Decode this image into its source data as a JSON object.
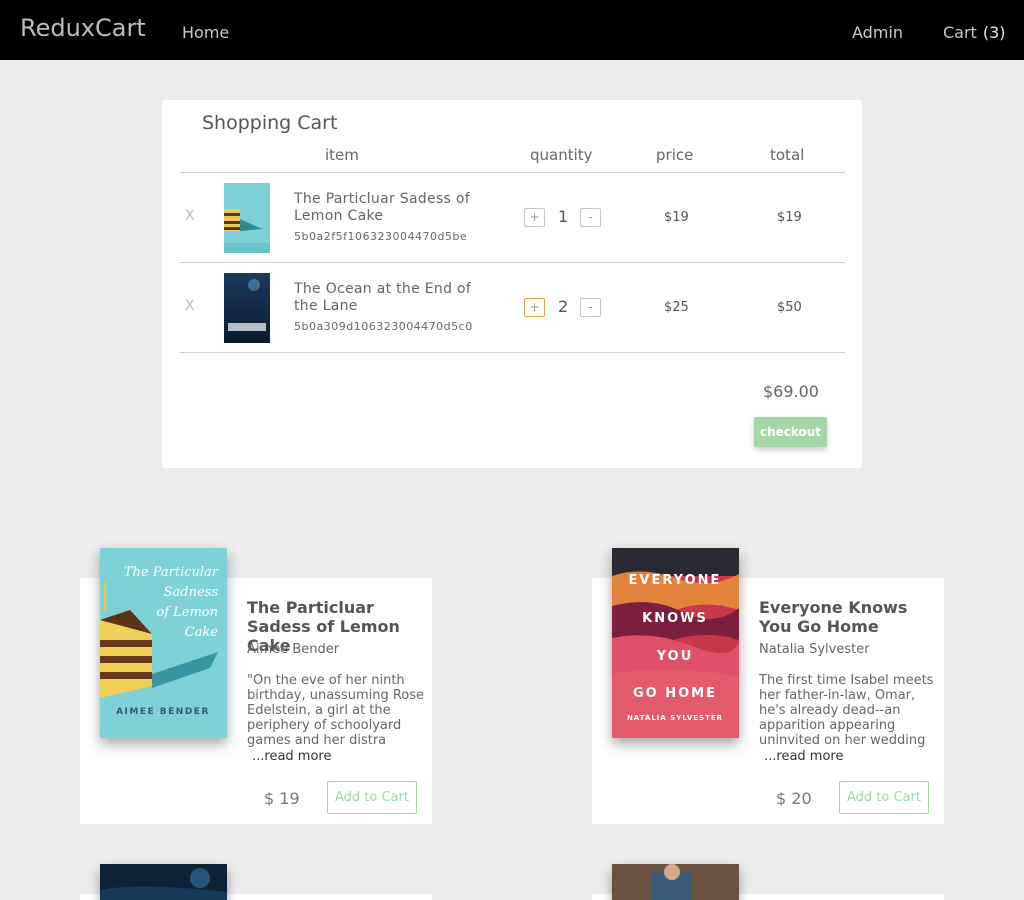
{
  "nav": {
    "brand": "ReduxCart",
    "home": "Home",
    "admin": "Admin",
    "cart_label": "Cart",
    "cart_count": "(3)"
  },
  "cart": {
    "title": "Shopping Cart",
    "headers": {
      "item": "item",
      "quantity": "quantity",
      "price": "price",
      "total": "total"
    },
    "remove_label": "X",
    "plus_label": "+",
    "minus_label": "-",
    "rows": [
      {
        "title": "The Particluar Sadess of Lemon Cake",
        "id": "5b0a2f5f106323004470d5be",
        "quantity": "1",
        "price": "$19",
        "total": "$19"
      },
      {
        "title": "The Ocean at the End of the Lane",
        "id": "5b0a309d106323004470d5c0",
        "quantity": "2",
        "price": "$25",
        "total": "$50"
      }
    ],
    "grand_total": "$69.00",
    "checkout": "checkout"
  },
  "products": [
    {
      "title": "The Particluar Sadess of Lemon Cake",
      "author": "Aimee Bender",
      "description": "\"On the eve of her ninth birthday, unassuming Rose Edelstein, a girl at the periphery of schoolyard games and her distra",
      "read_more": "...read more",
      "price": "$ 19",
      "add_to_cart": "Add to Cart",
      "cover_title": "The Particular Sadness of Lemon Cake",
      "cover_author": "AIMEE BENDER"
    },
    {
      "title": "Everyone Knows You Go Home",
      "author": "Natalia Sylvester",
      "description": "The first time Isabel meets her father-in-law, Omar, he's already dead--an apparition appearing uninvited on her wedding",
      "read_more": "...read more",
      "price": "$ 20",
      "add_to_cart": "Add to Cart",
      "cover_title": "EVERYONE KNOWS YOU GO HOME",
      "cover_author": "NATALIA SYLVESTER"
    }
  ],
  "colors": {
    "accent": "#a5d6a7",
    "navbar": "#000000",
    "background": "#ececec",
    "focus": "#d9a645"
  }
}
